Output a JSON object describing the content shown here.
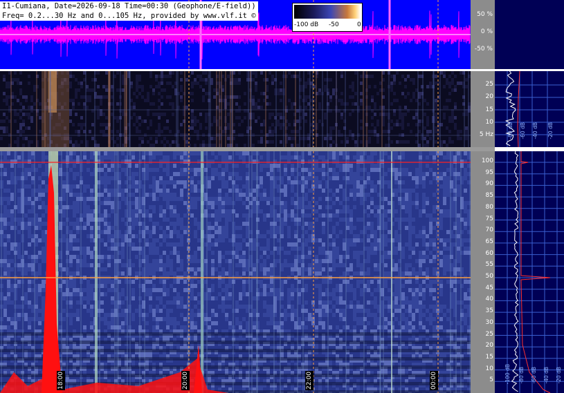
{
  "header": {
    "line1": "I1-Cumiana, Date=2026-09-18 Time=00:30 (Geophone/E-field))",
    "line2": "Freq= 0.2...30 Hz and 0...105 Hz, provided by www.vlf.it ©"
  },
  "colorbar": {
    "labels": [
      "-100 dB",
      "-50",
      "0"
    ]
  },
  "waveform_axis": {
    "ticks": [
      "50 %",
      "0 %",
      "-50 %"
    ]
  },
  "geophone_axis": {
    "ticks": [
      "25",
      "20",
      "15",
      "10",
      "5 Hz"
    ]
  },
  "vlf_axis": {
    "ticks": [
      "100",
      "95",
      "90",
      "85",
      "80",
      "75",
      "70",
      "65",
      "60",
      "55",
      "50",
      "45",
      "40",
      "35",
      "30",
      "25",
      "20",
      "15",
      "10",
      "5"
    ]
  },
  "time_labels": [
    "18:00",
    "20:00",
    "22:00",
    "00:00"
  ],
  "geo_profile_labels": [
    "-80 dB",
    "-60 dB",
    "-40 dB",
    "-20 dB"
  ],
  "vlf_profile_labels": [
    "-100 dB",
    "-80 dB",
    "-60 dB",
    "-40 dB",
    "-20 dB"
  ],
  "colors": {
    "waveform_bg": "#0000ff",
    "waveform_trace": "#ff00ff",
    "grid": "#ffa040",
    "marker": "#ff2020",
    "profile_bg": "#000055"
  }
}
